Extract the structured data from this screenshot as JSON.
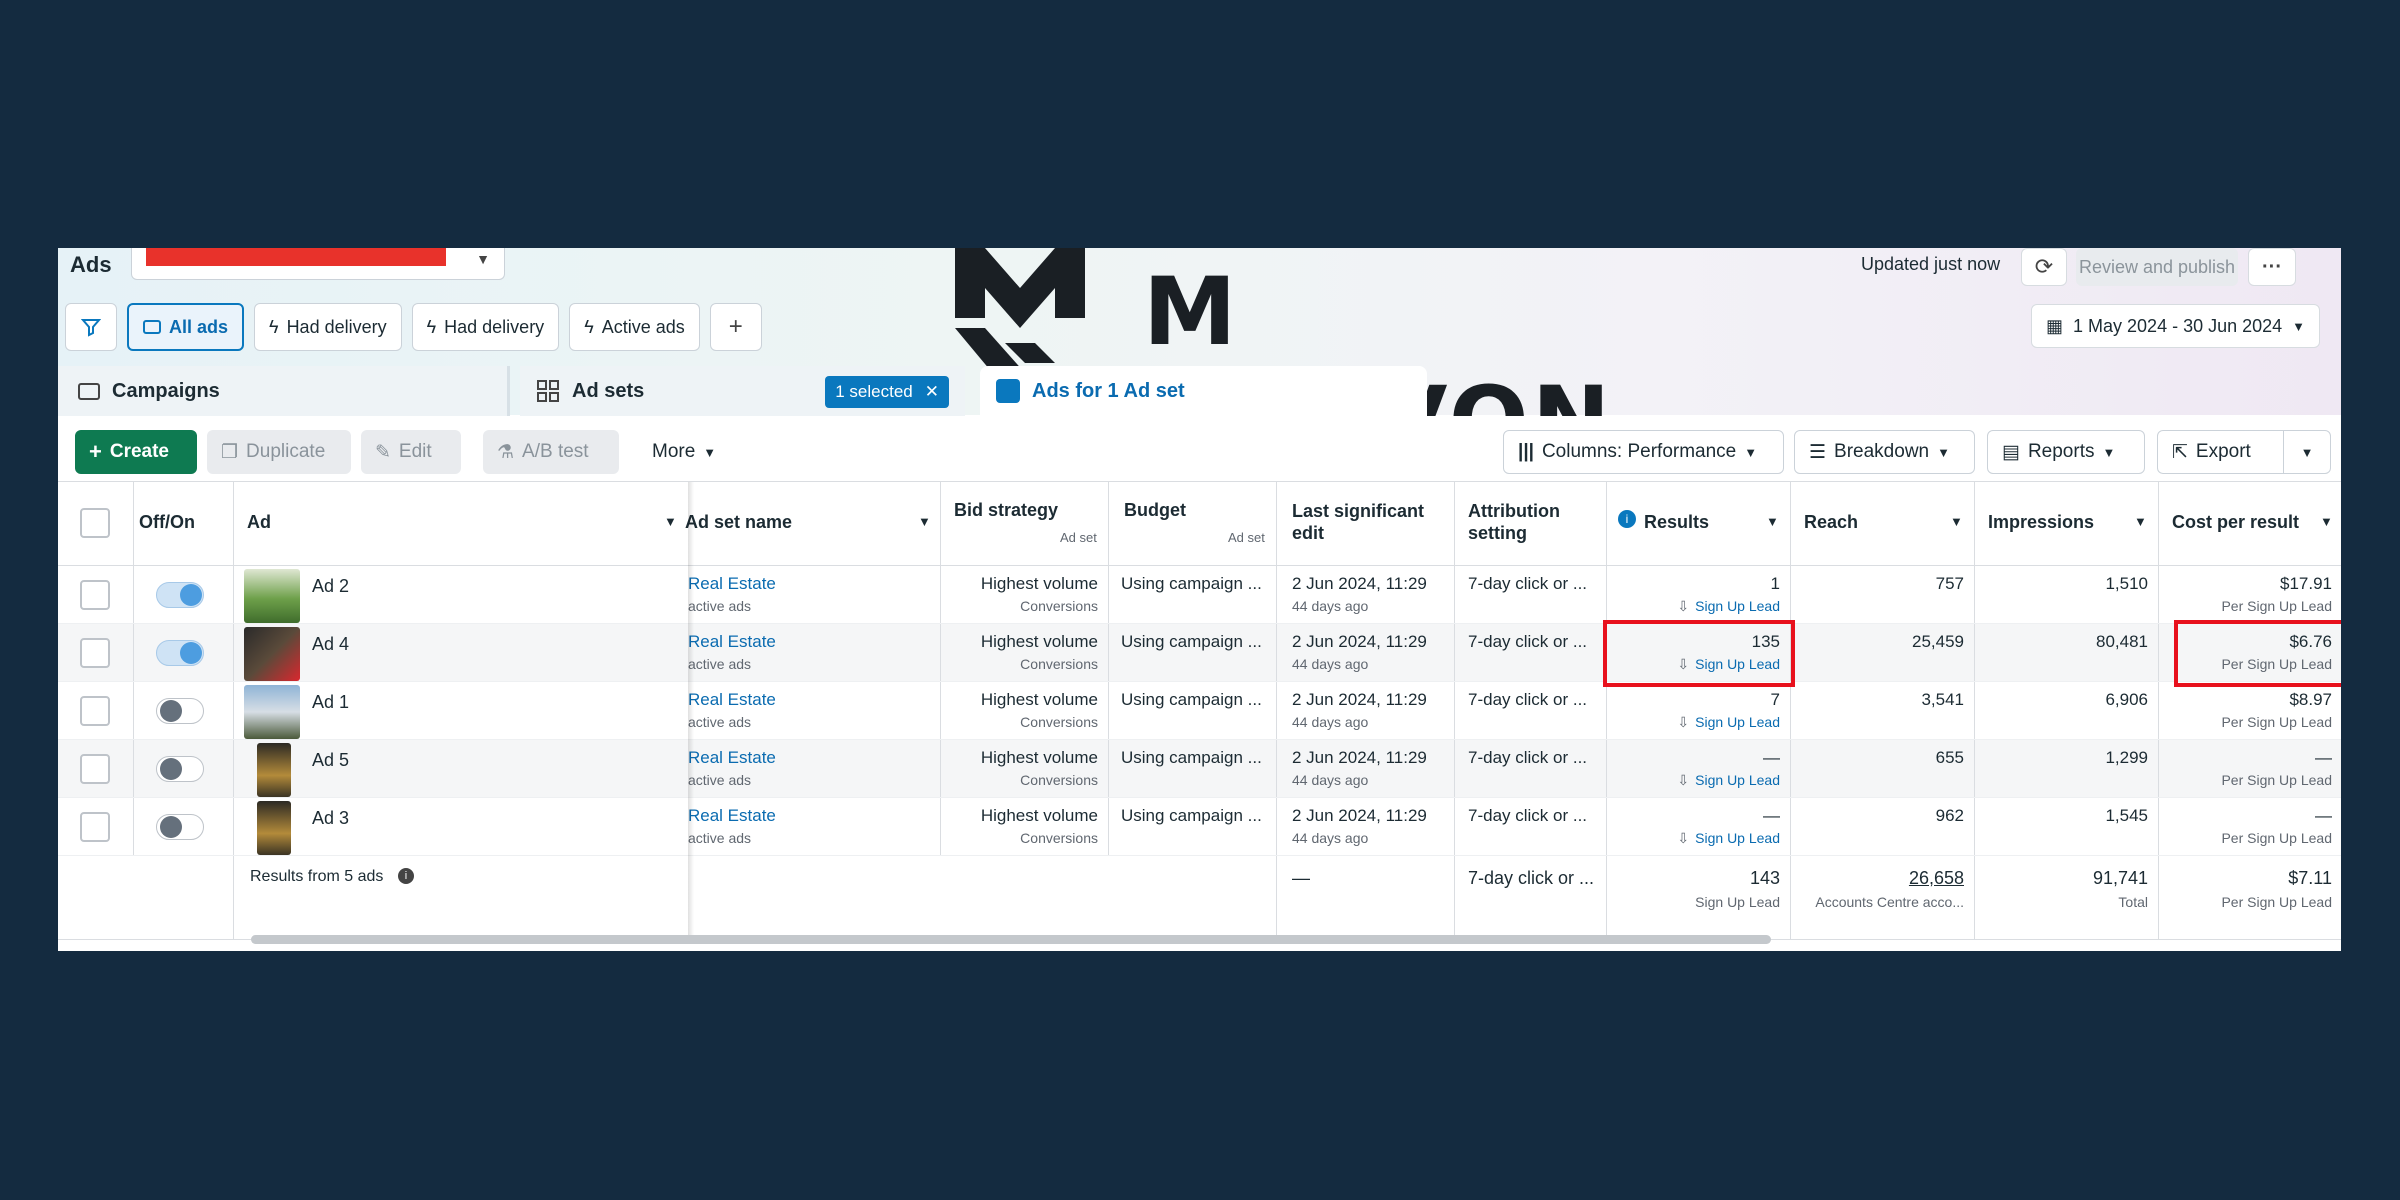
{
  "header": {
    "title": "Ads",
    "updated": "Updated just now",
    "review_publish": "Review and publish",
    "date_range": "1 May 2024 - 30 Jun 2024"
  },
  "watermark": {
    "text": "M SHUVON"
  },
  "filters": [
    {
      "label": "All ads",
      "selected": true
    },
    {
      "label": "Had delivery"
    },
    {
      "label": "Had delivery"
    },
    {
      "label": "Active ads"
    }
  ],
  "tabs": {
    "campaigns": "Campaigns",
    "adsets": "Ad sets",
    "selected_chip": "1 selected",
    "ads": "Ads for 1 Ad set"
  },
  "toolbar": {
    "create": "Create",
    "duplicate": "Duplicate",
    "edit": "Edit",
    "ab_test": "A/B test",
    "more": "More",
    "columns": "Columns: Performance",
    "breakdown": "Breakdown",
    "reports": "Reports",
    "export": "Export"
  },
  "columns": {
    "offon": "Off/On",
    "ad": "Ad",
    "adset_name": "Ad set name",
    "bid_strategy": "Bid strategy",
    "bid_strategy_sub": "Ad set",
    "budget": "Budget",
    "budget_sub": "Ad set",
    "last_edit": "Last significant edit",
    "attribution": "Attribution setting",
    "results": "Results",
    "reach": "Reach",
    "impressions": "Impressions",
    "cpr": "Cost per result"
  },
  "rows": [
    {
      "ad": "Ad 2",
      "on": true,
      "adset": "Real Estate",
      "adset_sub": "active ads",
      "bid": "Highest volume",
      "bid_sub": "Conversions",
      "budget": "Using campaign ...",
      "edit": "2 Jun 2024, 11:29",
      "edit_sub": "44 days ago",
      "attr": "7-day click or ...",
      "results": "1",
      "results_sub": "Sign Up Lead",
      "reach": "757",
      "impr": "1,510",
      "cpr": "$17.91",
      "cpr_sub": "Per Sign Up Lead"
    },
    {
      "ad": "Ad 4",
      "on": true,
      "adset": "Real Estate",
      "adset_sub": "active ads",
      "bid": "Highest volume",
      "bid_sub": "Conversions",
      "budget": "Using campaign ...",
      "edit": "2 Jun 2024, 11:29",
      "edit_sub": "44 days ago",
      "attr": "7-day click or ...",
      "results": "135",
      "results_sub": "Sign Up Lead",
      "reach": "25,459",
      "impr": "80,481",
      "cpr": "$6.76",
      "cpr_sub": "Per Sign Up Lead"
    },
    {
      "ad": "Ad 1",
      "on": false,
      "adset": "Real Estate",
      "adset_sub": "active ads",
      "bid": "Highest volume",
      "bid_sub": "Conversions",
      "budget": "Using campaign ...",
      "edit": "2 Jun 2024, 11:29",
      "edit_sub": "44 days ago",
      "attr": "7-day click or ...",
      "results": "7",
      "results_sub": "Sign Up Lead",
      "reach": "3,541",
      "impr": "6,906",
      "cpr": "$8.97",
      "cpr_sub": "Per Sign Up Lead"
    },
    {
      "ad": "Ad 5",
      "on": false,
      "adset": "Real Estate",
      "adset_sub": "active ads",
      "bid": "Highest volume",
      "bid_sub": "Conversions",
      "budget": "Using campaign ...",
      "edit": "2 Jun 2024, 11:29",
      "edit_sub": "44 days ago",
      "attr": "7-day click or ...",
      "results": "—",
      "results_sub": "Sign Up Lead",
      "reach": "655",
      "impr": "1,299",
      "cpr": "—",
      "cpr_sub": "Per Sign Up Lead"
    },
    {
      "ad": "Ad 3",
      "on": false,
      "adset": "Real Estate",
      "adset_sub": "active ads",
      "bid": "Highest volume",
      "bid_sub": "Conversions",
      "budget": "Using campaign ...",
      "edit": "2 Jun 2024, 11:29",
      "edit_sub": "44 days ago",
      "attr": "7-day click or ...",
      "results": "—",
      "results_sub": "Sign Up Lead",
      "reach": "962",
      "impr": "1,545",
      "cpr": "—",
      "cpr_sub": "Per Sign Up Lead"
    }
  ],
  "summary": {
    "label": "Results from 5 ads",
    "edit": "—",
    "attr": "7-day click or ...",
    "results": "143",
    "results_sub": "Sign Up Lead",
    "reach": "26,658",
    "reach_sub": "Accounts Centre acco...",
    "impr": "91,741",
    "impr_sub": "Total",
    "cpr": "$7.11",
    "cpr_sub": "Per Sign Up Lead"
  },
  "colors": {
    "accent": "#0a78be",
    "create": "#0e7a51",
    "highlight": "#e8111d"
  }
}
